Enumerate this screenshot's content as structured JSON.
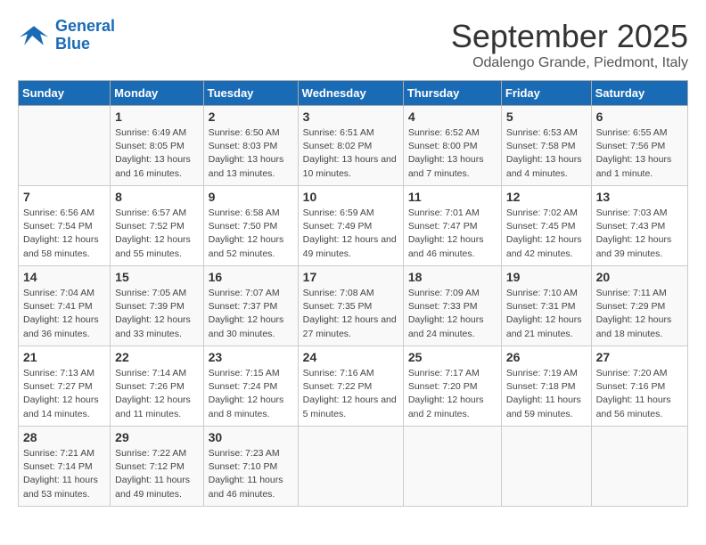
{
  "logo": {
    "line1": "General",
    "line2": "Blue"
  },
  "title": "September 2025",
  "location": "Odalengo Grande, Piedmont, Italy",
  "days_of_week": [
    "Sunday",
    "Monday",
    "Tuesday",
    "Wednesday",
    "Thursday",
    "Friday",
    "Saturday"
  ],
  "weeks": [
    [
      {
        "day": "",
        "sunrise": "",
        "sunset": "",
        "daylight": ""
      },
      {
        "day": "1",
        "sunrise": "Sunrise: 6:49 AM",
        "sunset": "Sunset: 8:05 PM",
        "daylight": "Daylight: 13 hours and 16 minutes."
      },
      {
        "day": "2",
        "sunrise": "Sunrise: 6:50 AM",
        "sunset": "Sunset: 8:03 PM",
        "daylight": "Daylight: 13 hours and 13 minutes."
      },
      {
        "day": "3",
        "sunrise": "Sunrise: 6:51 AM",
        "sunset": "Sunset: 8:02 PM",
        "daylight": "Daylight: 13 hours and 10 minutes."
      },
      {
        "day": "4",
        "sunrise": "Sunrise: 6:52 AM",
        "sunset": "Sunset: 8:00 PM",
        "daylight": "Daylight: 13 hours and 7 minutes."
      },
      {
        "day": "5",
        "sunrise": "Sunrise: 6:53 AM",
        "sunset": "Sunset: 7:58 PM",
        "daylight": "Daylight: 13 hours and 4 minutes."
      },
      {
        "day": "6",
        "sunrise": "Sunrise: 6:55 AM",
        "sunset": "Sunset: 7:56 PM",
        "daylight": "Daylight: 13 hours and 1 minute."
      }
    ],
    [
      {
        "day": "7",
        "sunrise": "Sunrise: 6:56 AM",
        "sunset": "Sunset: 7:54 PM",
        "daylight": "Daylight: 12 hours and 58 minutes."
      },
      {
        "day": "8",
        "sunrise": "Sunrise: 6:57 AM",
        "sunset": "Sunset: 7:52 PM",
        "daylight": "Daylight: 12 hours and 55 minutes."
      },
      {
        "day": "9",
        "sunrise": "Sunrise: 6:58 AM",
        "sunset": "Sunset: 7:50 PM",
        "daylight": "Daylight: 12 hours and 52 minutes."
      },
      {
        "day": "10",
        "sunrise": "Sunrise: 6:59 AM",
        "sunset": "Sunset: 7:49 PM",
        "daylight": "Daylight: 12 hours and 49 minutes."
      },
      {
        "day": "11",
        "sunrise": "Sunrise: 7:01 AM",
        "sunset": "Sunset: 7:47 PM",
        "daylight": "Daylight: 12 hours and 46 minutes."
      },
      {
        "day": "12",
        "sunrise": "Sunrise: 7:02 AM",
        "sunset": "Sunset: 7:45 PM",
        "daylight": "Daylight: 12 hours and 42 minutes."
      },
      {
        "day": "13",
        "sunrise": "Sunrise: 7:03 AM",
        "sunset": "Sunset: 7:43 PM",
        "daylight": "Daylight: 12 hours and 39 minutes."
      }
    ],
    [
      {
        "day": "14",
        "sunrise": "Sunrise: 7:04 AM",
        "sunset": "Sunset: 7:41 PM",
        "daylight": "Daylight: 12 hours and 36 minutes."
      },
      {
        "day": "15",
        "sunrise": "Sunrise: 7:05 AM",
        "sunset": "Sunset: 7:39 PM",
        "daylight": "Daylight: 12 hours and 33 minutes."
      },
      {
        "day": "16",
        "sunrise": "Sunrise: 7:07 AM",
        "sunset": "Sunset: 7:37 PM",
        "daylight": "Daylight: 12 hours and 30 minutes."
      },
      {
        "day": "17",
        "sunrise": "Sunrise: 7:08 AM",
        "sunset": "Sunset: 7:35 PM",
        "daylight": "Daylight: 12 hours and 27 minutes."
      },
      {
        "day": "18",
        "sunrise": "Sunrise: 7:09 AM",
        "sunset": "Sunset: 7:33 PM",
        "daylight": "Daylight: 12 hours and 24 minutes."
      },
      {
        "day": "19",
        "sunrise": "Sunrise: 7:10 AM",
        "sunset": "Sunset: 7:31 PM",
        "daylight": "Daylight: 12 hours and 21 minutes."
      },
      {
        "day": "20",
        "sunrise": "Sunrise: 7:11 AM",
        "sunset": "Sunset: 7:29 PM",
        "daylight": "Daylight: 12 hours and 18 minutes."
      }
    ],
    [
      {
        "day": "21",
        "sunrise": "Sunrise: 7:13 AM",
        "sunset": "Sunset: 7:27 PM",
        "daylight": "Daylight: 12 hours and 14 minutes."
      },
      {
        "day": "22",
        "sunrise": "Sunrise: 7:14 AM",
        "sunset": "Sunset: 7:26 PM",
        "daylight": "Daylight: 12 hours and 11 minutes."
      },
      {
        "day": "23",
        "sunrise": "Sunrise: 7:15 AM",
        "sunset": "Sunset: 7:24 PM",
        "daylight": "Daylight: 12 hours and 8 minutes."
      },
      {
        "day": "24",
        "sunrise": "Sunrise: 7:16 AM",
        "sunset": "Sunset: 7:22 PM",
        "daylight": "Daylight: 12 hours and 5 minutes."
      },
      {
        "day": "25",
        "sunrise": "Sunrise: 7:17 AM",
        "sunset": "Sunset: 7:20 PM",
        "daylight": "Daylight: 12 hours and 2 minutes."
      },
      {
        "day": "26",
        "sunrise": "Sunrise: 7:19 AM",
        "sunset": "Sunset: 7:18 PM",
        "daylight": "Daylight: 11 hours and 59 minutes."
      },
      {
        "day": "27",
        "sunrise": "Sunrise: 7:20 AM",
        "sunset": "Sunset: 7:16 PM",
        "daylight": "Daylight: 11 hours and 56 minutes."
      }
    ],
    [
      {
        "day": "28",
        "sunrise": "Sunrise: 7:21 AM",
        "sunset": "Sunset: 7:14 PM",
        "daylight": "Daylight: 11 hours and 53 minutes."
      },
      {
        "day": "29",
        "sunrise": "Sunrise: 7:22 AM",
        "sunset": "Sunset: 7:12 PM",
        "daylight": "Daylight: 11 hours and 49 minutes."
      },
      {
        "day": "30",
        "sunrise": "Sunrise: 7:23 AM",
        "sunset": "Sunset: 7:10 PM",
        "daylight": "Daylight: 11 hours and 46 minutes."
      },
      {
        "day": "",
        "sunrise": "",
        "sunset": "",
        "daylight": ""
      },
      {
        "day": "",
        "sunrise": "",
        "sunset": "",
        "daylight": ""
      },
      {
        "day": "",
        "sunrise": "",
        "sunset": "",
        "daylight": ""
      },
      {
        "day": "",
        "sunrise": "",
        "sunset": "",
        "daylight": ""
      }
    ]
  ]
}
